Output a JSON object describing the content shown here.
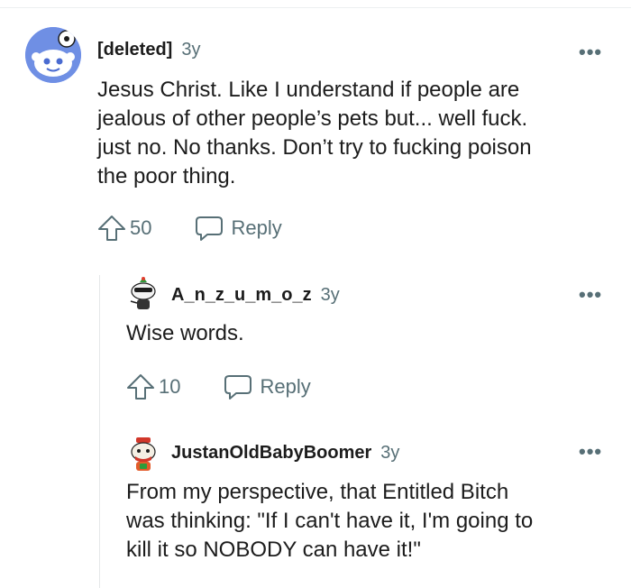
{
  "comments": [
    {
      "author": "[deleted]",
      "age": "3y",
      "more": "•••",
      "body_lines": [
        "Jesus Christ. Like I understand if people are",
        "jealous of other people’s pets but... well fuck.",
        "just no. No thanks. Don’t try to fucking poison",
        "the poor thing."
      ],
      "votes": "50",
      "reply_label": "Reply"
    },
    {
      "author": "A_n_z_u_m_o_z",
      "age": "3y",
      "more": "•••",
      "body_lines": [
        "Wise words."
      ],
      "votes": "10",
      "reply_label": "Reply"
    },
    {
      "author": "JustanOldBabyBoomer",
      "age": "3y",
      "more": "•••",
      "body_lines": [
        "From my perspective, that Entitled Bitch",
        "was thinking: \"If I can't have it, I'm going to",
        "kill it so NOBODY can have it!\""
      ]
    }
  ],
  "colors": {
    "meta_gray": "#576f76",
    "text": "#1c1c1c",
    "avatar_blue": "#6b8fe0",
    "thread_line": "#e5e7e9"
  }
}
